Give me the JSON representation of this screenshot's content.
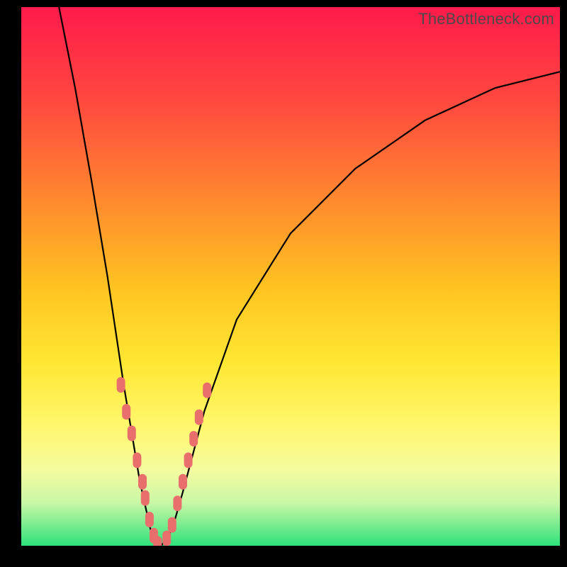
{
  "watermark": "TheBottleneck.com",
  "colors": {
    "bead": "#e86f6c",
    "curve": "#000000",
    "frame": "#000000"
  },
  "chart_data": {
    "type": "line",
    "title": "",
    "xlabel": "",
    "ylabel": "",
    "xlim": [
      0,
      100
    ],
    "ylim": [
      0,
      100
    ],
    "grid": false,
    "legend": false,
    "note": "V-shaped bottleneck curve: y≈100 at x≈7, drops to y≈0 near x≈25, rises back toward y≈88 at x≈100. Accent band (green) at bottom; beads mark the lowest ~30% of the curve.",
    "curve_points": [
      {
        "x": 7,
        "y": 100
      },
      {
        "x": 10,
        "y": 85
      },
      {
        "x": 13,
        "y": 68
      },
      {
        "x": 16,
        "y": 50
      },
      {
        "x": 19,
        "y": 30
      },
      {
        "x": 22,
        "y": 12
      },
      {
        "x": 24,
        "y": 3
      },
      {
        "x": 26,
        "y": 0
      },
      {
        "x": 28,
        "y": 3
      },
      {
        "x": 30,
        "y": 10
      },
      {
        "x": 34,
        "y": 25
      },
      {
        "x": 40,
        "y": 42
      },
      {
        "x": 50,
        "y": 58
      },
      {
        "x": 62,
        "y": 70
      },
      {
        "x": 75,
        "y": 79
      },
      {
        "x": 88,
        "y": 85
      },
      {
        "x": 100,
        "y": 88
      }
    ],
    "beads_left": [
      {
        "x": 18.5,
        "y": 30
      },
      {
        "x": 19.5,
        "y": 25
      },
      {
        "x": 20.5,
        "y": 21
      },
      {
        "x": 21.5,
        "y": 16
      },
      {
        "x": 22.5,
        "y": 12
      },
      {
        "x": 23.0,
        "y": 9
      },
      {
        "x": 23.8,
        "y": 5
      },
      {
        "x": 24.6,
        "y": 2
      },
      {
        "x": 25.3,
        "y": 0.5
      }
    ],
    "beads_right": [
      {
        "x": 27.0,
        "y": 1.5
      },
      {
        "x": 28.0,
        "y": 4
      },
      {
        "x": 29.0,
        "y": 8
      },
      {
        "x": 30.0,
        "y": 12
      },
      {
        "x": 31.0,
        "y": 16
      },
      {
        "x": 32.0,
        "y": 20
      },
      {
        "x": 33.0,
        "y": 24
      },
      {
        "x": 34.5,
        "y": 29
      }
    ]
  }
}
